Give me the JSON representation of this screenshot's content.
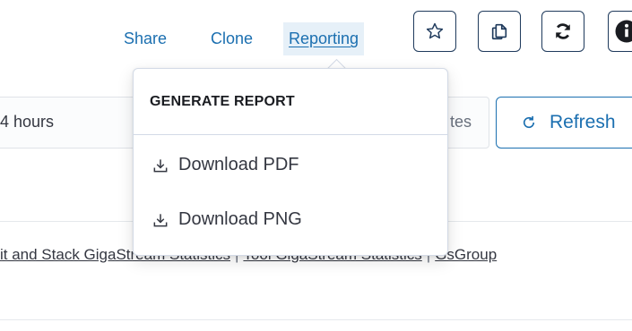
{
  "header": {
    "share_label": "Share",
    "clone_label": "Clone",
    "reporting_label": "Reporting"
  },
  "toolbar": {
    "favorite_icon": "star-icon",
    "copy_icon": "copy-icon",
    "sync_icon": "sync-icon",
    "help_icon": "help-icon"
  },
  "time": {
    "range_label": "4 hours",
    "minutes_label": "tes",
    "refresh_label": "Refresh"
  },
  "breadcrumb": {
    "item1": "it and Stack GigaStream Statistics",
    "item2": "Tool GigaStream Statistics",
    "item3": "GsGroup",
    "separator": "|"
  },
  "popover": {
    "title": "GENERATE REPORT",
    "items": [
      {
        "label": "Download PDF",
        "icon": "download-icon"
      },
      {
        "label": "Download PNG",
        "icon": "download-icon"
      }
    ]
  },
  "colors": {
    "link": "#1b6fb0",
    "reporting_bg": "#e6f0f8",
    "button_border": "#1f3a5c"
  }
}
